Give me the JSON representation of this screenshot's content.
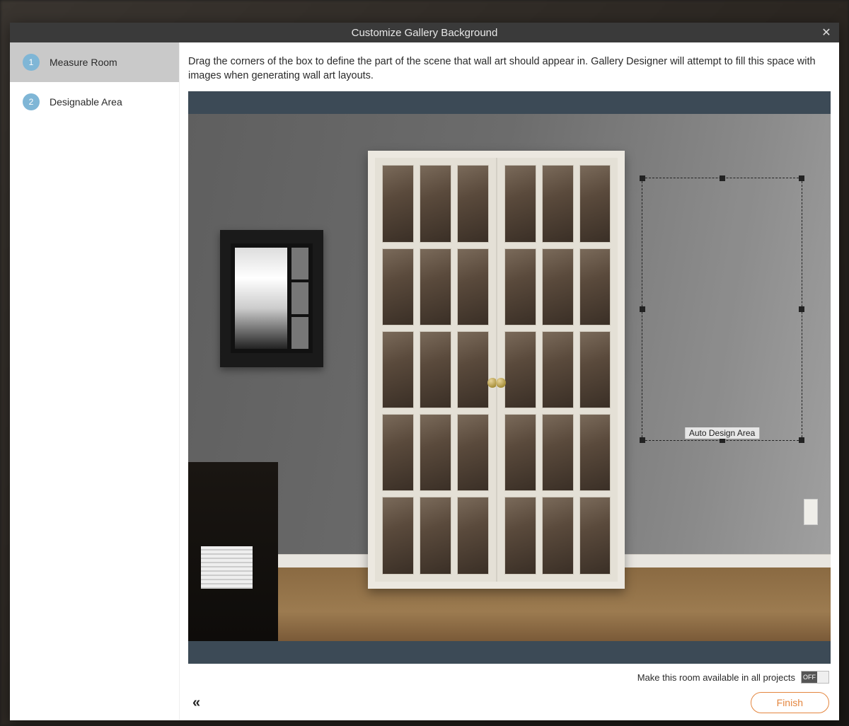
{
  "title": "Customize Gallery Background",
  "steps": [
    {
      "num": "1",
      "label": "Measure Room",
      "active": true
    },
    {
      "num": "2",
      "label": "Designable Area",
      "active": false
    }
  ],
  "instructions": "Drag the corners of the box to define the part of the scene that wall art should appear in. Gallery Designer will attempt to fill this space with images when generating wall art layouts.",
  "selection_label": "Auto Design Area",
  "footer": {
    "share_label": "Make this room available in all projects",
    "toggle_state": "OFF",
    "finish_label": "Finish"
  }
}
